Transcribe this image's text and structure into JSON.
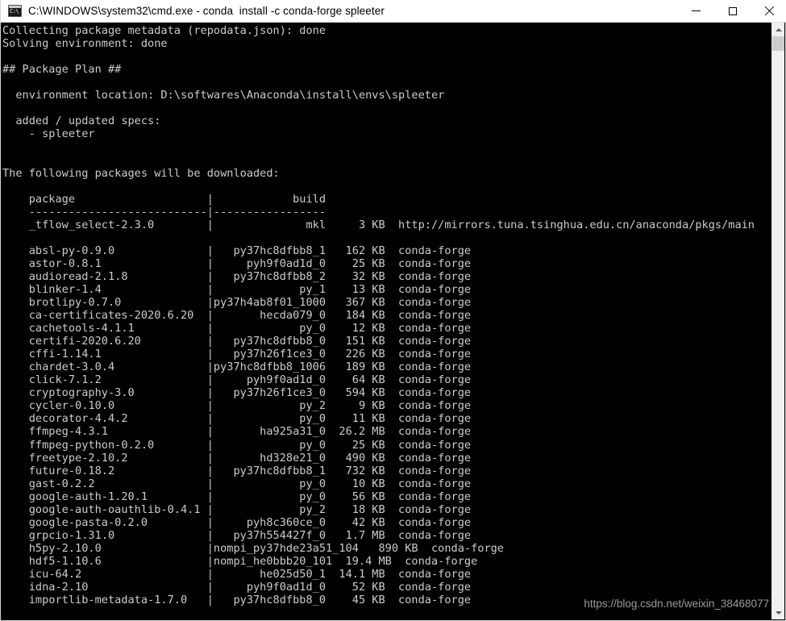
{
  "window": {
    "title": "C:\\WINDOWS\\system32\\cmd.exe - conda  install -c conda-forge spleeter",
    "icon_glyph": "C:\\",
    "icon_name": "cmd-console-icon",
    "controls": {
      "minimize_label": "Minimize",
      "maximize_label": "Maximize",
      "close_label": "Close"
    },
    "background_color": "#000000",
    "titlebar_color": "#ffffff",
    "text_color": "#cccccc"
  },
  "scrollbar": {
    "up_arrow": "▲",
    "down_arrow": "▼",
    "thumb_position_percent": 2,
    "thumb_color": "#cdcdcd",
    "track_color": "#f0f0f0"
  },
  "watermark": {
    "text": "https://blog.csdn.net/weixin_38468077"
  },
  "terminal": {
    "header_lines": [
      "Collecting package metadata (repodata.json): done",
      "Solving environment: done",
      "",
      "## Package Plan ##",
      "",
      "  environment location: D:\\softwares\\Anaconda\\install\\envs\\spleeter",
      "",
      "  added / updated specs:",
      "    - spleeter",
      "",
      "",
      "The following packages will be downloaded:",
      ""
    ],
    "table": {
      "column_headers": {
        "package": "package",
        "build": "build"
      },
      "header_line": "    package                    |            build",
      "separator_line": "    ---------------------------|-----------------",
      "columns": {
        "package_width": 27,
        "build_width": 17,
        "size_width": 9,
        "indent": 4
      },
      "rows": [
        {
          "package": "_tflow_select-2.3.0",
          "build": "mkl",
          "size": "3 KB",
          "channel": "http://mirrors.tuna.tsinghua.edu.cn/anaconda/pkgs/main"
        },
        {
          "package": "",
          "build": "",
          "size": "",
          "channel": ""
        },
        {
          "package": "absl-py-0.9.0",
          "build": "py37hc8dfbb8_1",
          "size": "162 KB",
          "channel": "conda-forge"
        },
        {
          "package": "astor-0.8.1",
          "build": "pyh9f0ad1d_0",
          "size": "25 KB",
          "channel": "conda-forge"
        },
        {
          "package": "audioread-2.1.8",
          "build": "py37hc8dfbb8_2",
          "size": "32 KB",
          "channel": "conda-forge"
        },
        {
          "package": "blinker-1.4",
          "build": "py_1",
          "size": "13 KB",
          "channel": "conda-forge"
        },
        {
          "package": "brotlipy-0.7.0",
          "build": "py37h4ab8f01_1000",
          "size": "367 KB",
          "channel": "conda-forge"
        },
        {
          "package": "ca-certificates-2020.6.20",
          "build": "hecda079_0",
          "size": "184 KB",
          "channel": "conda-forge"
        },
        {
          "package": "cachetools-4.1.1",
          "build": "py_0",
          "size": "12 KB",
          "channel": "conda-forge"
        },
        {
          "package": "certifi-2020.6.20",
          "build": "py37hc8dfbb8_0",
          "size": "151 KB",
          "channel": "conda-forge"
        },
        {
          "package": "cffi-1.14.1",
          "build": "py37h26f1ce3_0",
          "size": "226 KB",
          "channel": "conda-forge"
        },
        {
          "package": "chardet-3.0.4",
          "build": "py37hc8dfbb8_1006",
          "size": "189 KB",
          "channel": "conda-forge"
        },
        {
          "package": "click-7.1.2",
          "build": "pyh9f0ad1d_0",
          "size": "64 KB",
          "channel": "conda-forge"
        },
        {
          "package": "cryptography-3.0",
          "build": "py37h26f1ce3_0",
          "size": "594 KB",
          "channel": "conda-forge"
        },
        {
          "package": "cycler-0.10.0",
          "build": "py_2",
          "size": "9 KB",
          "channel": "conda-forge"
        },
        {
          "package": "decorator-4.4.2",
          "build": "py_0",
          "size": "11 KB",
          "channel": "conda-forge"
        },
        {
          "package": "ffmpeg-4.3.1",
          "build": "ha925a31_0",
          "size": "26.2 MB",
          "channel": "conda-forge"
        },
        {
          "package": "ffmpeg-python-0.2.0",
          "build": "py_0",
          "size": "25 KB",
          "channel": "conda-forge"
        },
        {
          "package": "freetype-2.10.2",
          "build": "hd328e21_0",
          "size": "490 KB",
          "channel": "conda-forge"
        },
        {
          "package": "future-0.18.2",
          "build": "py37hc8dfbb8_1",
          "size": "732 KB",
          "channel": "conda-forge"
        },
        {
          "package": "gast-0.2.2",
          "build": "py_0",
          "size": "10 KB",
          "channel": "conda-forge"
        },
        {
          "package": "google-auth-1.20.1",
          "build": "py_0",
          "size": "56 KB",
          "channel": "conda-forge"
        },
        {
          "package": "google-auth-oauthlib-0.4.1",
          "build": "py_2",
          "size": "18 KB",
          "channel": "conda-forge"
        },
        {
          "package": "google-pasta-0.2.0",
          "build": "pyh8c360ce_0",
          "size": "42 KB",
          "channel": "conda-forge"
        },
        {
          "package": "grpcio-1.31.0",
          "build": "py37h554427f_0",
          "size": "1.7 MB",
          "channel": "conda-forge"
        },
        {
          "package": "h5py-2.10.0",
          "build": "nompi_py37hde23a51_104",
          "size": "890 KB",
          "channel": "conda-forge"
        },
        {
          "package": "hdf5-1.10.6",
          "build": "nompi_he0bbb20_101",
          "size": "19.4 MB",
          "channel": "conda-forge"
        },
        {
          "package": "icu-64.2",
          "build": "he025d50_1",
          "size": "14.1 MB",
          "channel": "conda-forge"
        },
        {
          "package": "idna-2.10",
          "build": "pyh9f0ad1d_0",
          "size": "52 KB",
          "channel": "conda-forge"
        },
        {
          "package": "importlib-metadata-1.7.0",
          "build": "py37hc8dfbb8_0",
          "size": "45 KB",
          "channel": "conda-forge"
        }
      ]
    }
  }
}
